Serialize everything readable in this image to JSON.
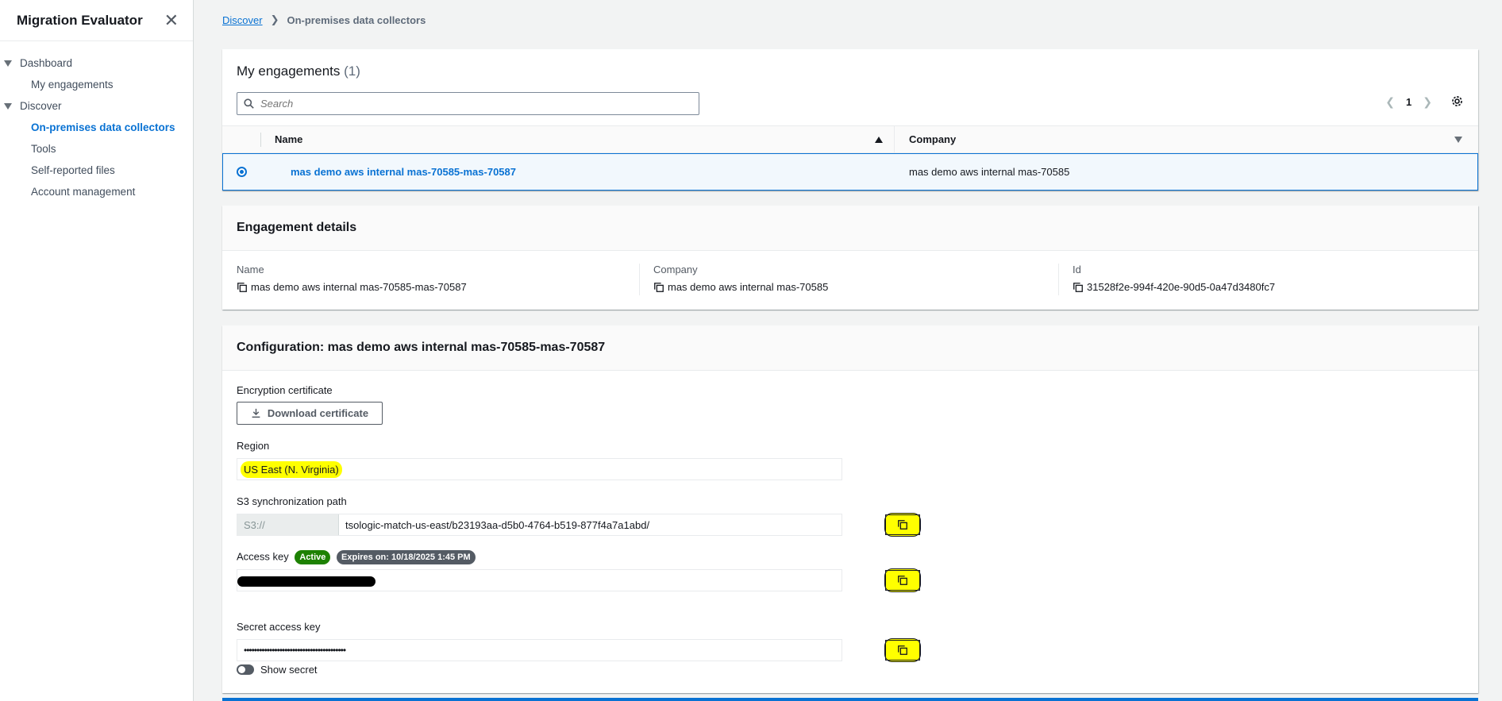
{
  "sidebar": {
    "title": "Migration Evaluator",
    "groups": [
      {
        "label": "Dashboard",
        "items": [
          "My engagements"
        ]
      },
      {
        "label": "Discover",
        "items": [
          "On-premises data collectors",
          "Tools",
          "Self-reported files",
          "Account management"
        ]
      }
    ]
  },
  "breadcrumb": {
    "root": "Discover",
    "current": "On-premises data collectors"
  },
  "engagements": {
    "title": "My engagements",
    "count": "(1)",
    "search_placeholder": "Search",
    "page": "1",
    "columns": {
      "name": "Name",
      "company": "Company"
    },
    "rows": [
      {
        "name": "mas demo aws internal mas-70585-mas-70587",
        "company": "mas demo aws internal mas-70585"
      }
    ]
  },
  "details": {
    "title": "Engagement details",
    "name_label": "Name",
    "name_value": "mas demo aws internal mas-70585-mas-70587",
    "company_label": "Company",
    "company_value": "mas demo aws internal mas-70585",
    "id_label": "Id",
    "id_value": "31528f2e-994f-420e-90d5-0a47d3480fc7"
  },
  "config": {
    "title": "Configuration:  mas demo aws internal mas-70585-mas-70587",
    "cert_label": "Encryption certificate",
    "download_label": "Download certificate",
    "region_label": "Region",
    "region_value": "US East (N. Virginia)",
    "s3_label": "S3 synchronization path",
    "s3_prefix": "S3://",
    "s3_path": "tsologic-match-us-east/b23193aa-d5b0-4764-b519-877f4a7a1abd/",
    "access_label": "Access key",
    "access_status": "Active",
    "access_expiry": "Expires on:  10/18/2025 1:45 PM",
    "secret_label": "Secret access key",
    "secret_masked": "••••••••••••••••••••••••••••••••••••••••",
    "show_secret": "Show secret"
  },
  "colors": {
    "accent": "#0972d3",
    "active_badge": "#1d8102",
    "highlight": "#ffff00"
  }
}
